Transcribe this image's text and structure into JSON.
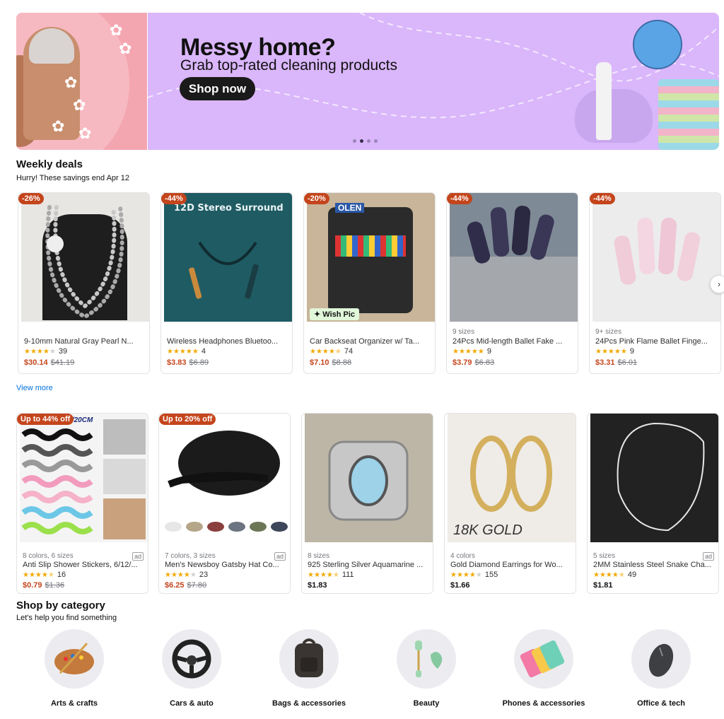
{
  "hero": {
    "title": "Messy home?",
    "subtitle": "Grab top-rated cleaning products",
    "cta": "Shop now",
    "bg_color": "#dab6fb"
  },
  "weekly": {
    "title": "Weekly deals",
    "subtitle": "Hurry! These savings end Apr 12",
    "view_more": "View more",
    "products": [
      {
        "badge": "-26%",
        "meta": "",
        "name": "9-10mm Natural Gray Pearl N...",
        "rating": 4,
        "reviews": "39",
        "price": "$30.14",
        "old": "$41.19"
      },
      {
        "badge": "-44%",
        "meta": "",
        "name": "Wireless Headphones Bluetoo...",
        "rating": 5,
        "reviews": "4",
        "price": "$3.83",
        "old": "$6.89"
      },
      {
        "badge": "-20%",
        "meta": "",
        "name": "Car Backseat Organizer w/ Ta...",
        "rating": 4.5,
        "reviews": "74",
        "price": "$7.10",
        "old": "$8.88",
        "tag": "Wish Pic"
      },
      {
        "badge": "-44%",
        "meta": "9 sizes",
        "name": "24Pcs Mid-length Ballet Fake ...",
        "rating": 5,
        "reviews": "9",
        "price": "$3.79",
        "old": "$6.83"
      },
      {
        "badge": "-44%",
        "meta": "9+ sizes",
        "name": "24Pcs Pink Flame Ballet Finge...",
        "rating": 5,
        "reviews": "9",
        "price": "$3.31",
        "old": "$6.01"
      }
    ]
  },
  "more": {
    "products": [
      {
        "badge": "Up to 44% off",
        "meta": "8 colors, 6 sizes",
        "ad": "ad",
        "name": "Anti Slip Shower Stickers, 6/12/...",
        "rating": 4.5,
        "reviews": "16",
        "price": "$0.79",
        "old": "$1.36",
        "img_text": "6/12/24PCS 10/20CM"
      },
      {
        "badge": "Up to 20% off",
        "meta": "7 colors, 3 sizes",
        "ad": "ad",
        "name": "Men's Newsboy Gatsby Hat Co...",
        "rating": 4,
        "reviews": "23",
        "price": "$6.25",
        "old": "$7.80"
      },
      {
        "badge": "",
        "meta": "8 sizes",
        "ad": "",
        "name": "925 Sterling Silver Aquamarine ...",
        "rating": 4.5,
        "reviews": "111",
        "price": "$1.83",
        "old": ""
      },
      {
        "badge": "",
        "meta": "4 colors",
        "ad": "",
        "name": "Gold Diamond Earrings for Wo...",
        "rating": 4,
        "reviews": "155",
        "price": "$1.66",
        "old": "",
        "img_text": "18K GOLD"
      },
      {
        "badge": "",
        "meta": "5 sizes",
        "ad": "ad",
        "name": "2MM Stainless Steel Snake Cha...",
        "rating": 4.5,
        "reviews": "49",
        "price": "$1.81",
        "old": ""
      }
    ]
  },
  "categories": {
    "title": "Shop by category",
    "subtitle": "Let's help you find something",
    "items": [
      {
        "label": "Arts & crafts",
        "icon": "palette-icon"
      },
      {
        "label": "Cars & auto",
        "icon": "steering-wheel-icon"
      },
      {
        "label": "Bags & accessories",
        "icon": "backpack-icon"
      },
      {
        "label": "Beauty",
        "icon": "jade-roller-icon"
      },
      {
        "label": "Phones & accessories",
        "icon": "phone-cases-icon"
      },
      {
        "label": "Office & tech",
        "icon": "mouse-icon"
      }
    ]
  },
  "colors": {
    "sale": "#c4451c",
    "link": "#0071dc",
    "star": "#f2a900"
  }
}
